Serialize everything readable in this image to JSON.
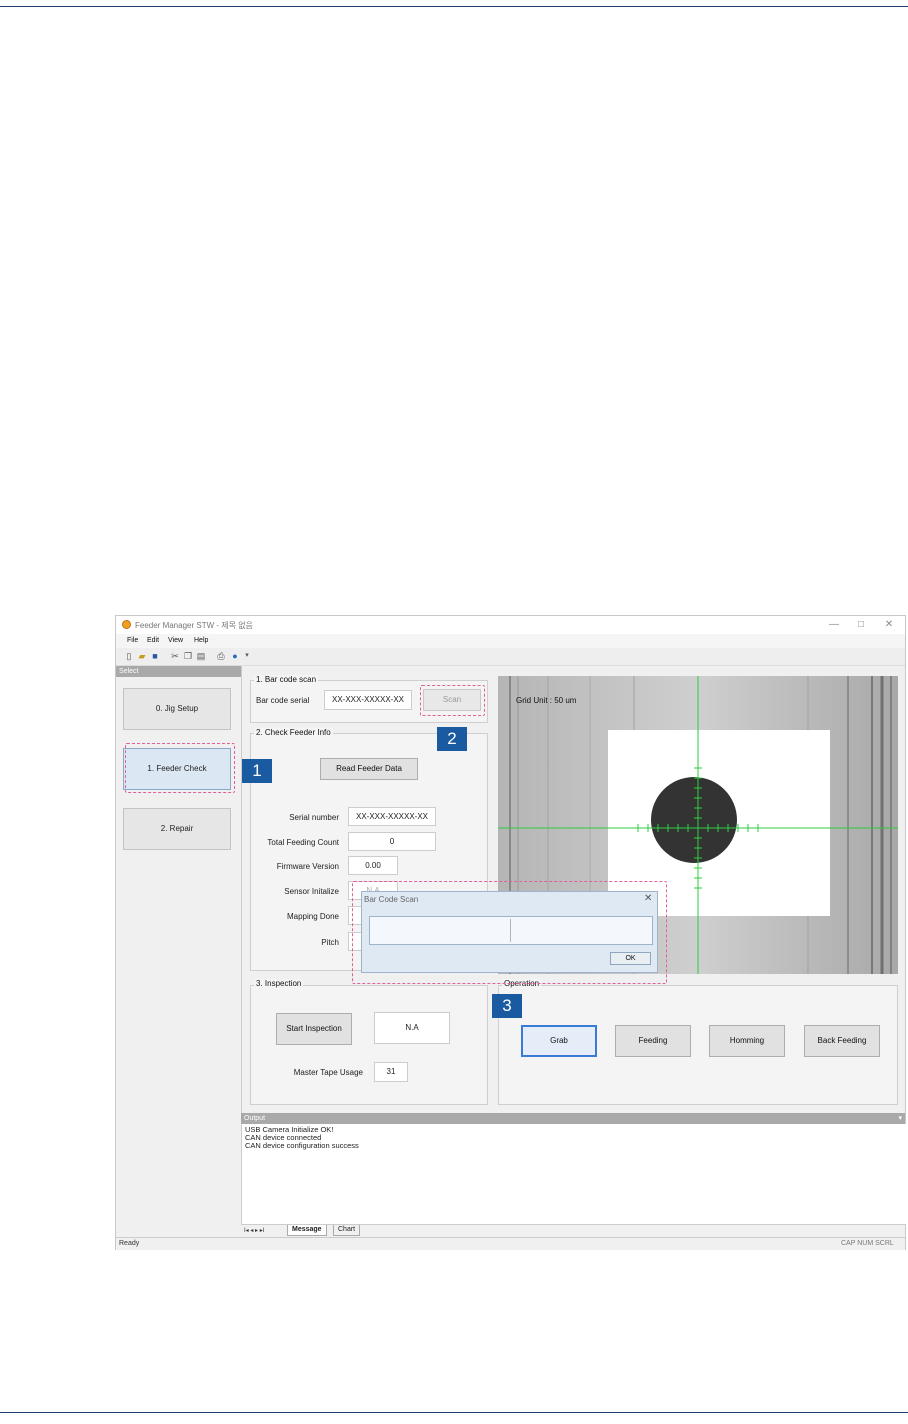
{
  "window": {
    "title": "Feeder Manager STW - 제목 없음",
    "minimize_glyph": "—",
    "maximize_glyph": "□",
    "close_glyph": "✕"
  },
  "menu": [
    "File",
    "Edit",
    "View",
    "Help"
  ],
  "left_panel": {
    "header": "Select",
    "buttons": [
      "0. Jig Setup",
      "1. Feeder Check",
      "2. Repair"
    ]
  },
  "barcode_scan": {
    "title": "1. Bar code scan",
    "label": "Bar code serial",
    "value": "XX-XXX-XXXXX-XX",
    "scan_button": "Scan"
  },
  "feeder_info": {
    "title": "2. Check Feeder Info",
    "read_button": "Read Feeder Data",
    "fields": [
      {
        "label": "Serial number",
        "value": "XX-XXX-XXXXX-XX"
      },
      {
        "label": "Total Feeding Count",
        "value": "0"
      },
      {
        "label": "Firmware Version",
        "value": "0.00"
      },
      {
        "label": "Sensor Initalize",
        "value": "N.A"
      },
      {
        "label": "Mapping Done",
        "value": ""
      },
      {
        "label": "Pitch",
        "value": ""
      }
    ]
  },
  "camera": {
    "grid_label": "Grid Unit : 50 um"
  },
  "inspection": {
    "title": "3. Inspection",
    "start_button": "Start Inspection",
    "result": "N.A",
    "master_label": "Master Tape Usage",
    "master_value": "31"
  },
  "operation": {
    "title": "Operation",
    "buttons": [
      "Grab",
      "Feeding",
      "Homming",
      "Back Feeding"
    ]
  },
  "dialog": {
    "title": "Bar Code Scan",
    "close_glyph": "✕",
    "input_value": "",
    "ok_button": "OK"
  },
  "output": {
    "header": "Output",
    "lines": [
      "USB Camera Initialize OK!",
      "CAN device connected",
      "CAN device configuration success"
    ],
    "tabs": [
      "Message",
      "Chart"
    ],
    "nav_glyphs": "I◂ ◂ ▸ ▸I"
  },
  "status": {
    "left": "Ready",
    "right": "CAP NUM SCRL"
  },
  "callouts": [
    "1",
    "2",
    "3"
  ],
  "colors": {
    "accent_blue": "#1a5aa0",
    "highlight_dash": "#e0609a",
    "crosshair_green": "#2ecc40"
  }
}
